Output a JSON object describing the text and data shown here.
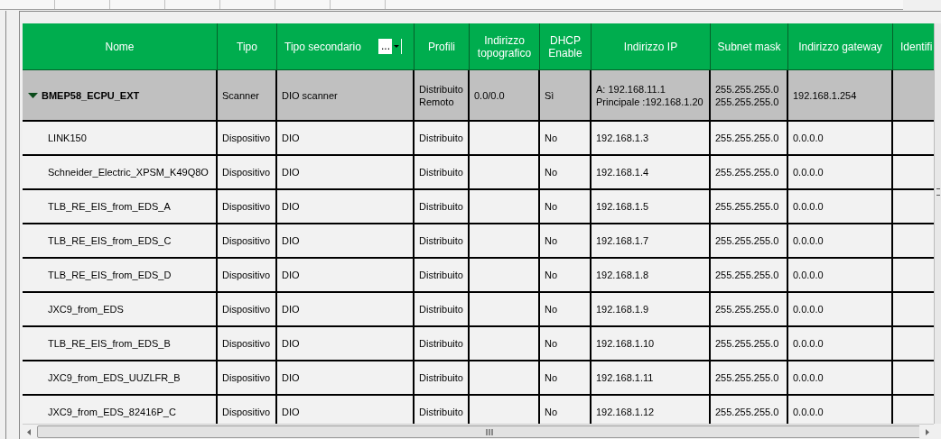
{
  "columns": [
    {
      "label": "Nome"
    },
    {
      "label": "Tipo"
    },
    {
      "label": "Tipo secondario",
      "filter": "..."
    },
    {
      "label": "Profili"
    },
    {
      "label": "Indirizzo topografico"
    },
    {
      "label": "DHCP Enable"
    },
    {
      "label": "Indirizzo IP"
    },
    {
      "label": "Subnet mask"
    },
    {
      "label": "Indirizzo gateway"
    },
    {
      "label": "Identifi"
    }
  ],
  "group": {
    "nome": "BMEP58_ECPU_EXT",
    "expanded": true,
    "tipo": "Scanner",
    "tipo_secondario": "DIO scanner",
    "profili": [
      "Distribuito",
      "Remoto"
    ],
    "indirizzo_topografico": "0.0/0.0",
    "dhcp_enable": "Sì",
    "indirizzo_ip": [
      "A: 192.168.11.1",
      "Principale :192.168.1.20"
    ],
    "subnet_mask": [
      "255.255.255.0",
      "255.255.255.0"
    ],
    "indirizzo_gateway": "192.168.1.254"
  },
  "rows": [
    {
      "nome": "LINK150",
      "tipo": "Dispositivo",
      "tipo_secondario": "DIO",
      "profili": "Distribuito",
      "dhcp_enable": "No",
      "indirizzo_ip": "192.168.1.3",
      "subnet_mask": "255.255.255.0",
      "indirizzo_gateway": "0.0.0.0"
    },
    {
      "nome": "Schneider_Electric_XPSM_K49Q8O",
      "tipo": "Dispositivo",
      "tipo_secondario": "DIO",
      "profili": "Distribuito",
      "dhcp_enable": "No",
      "indirizzo_ip": "192.168.1.4",
      "subnet_mask": "255.255.255.0",
      "indirizzo_gateway": "0.0.0.0"
    },
    {
      "nome": "TLB_RE_EIS_from_EDS_A",
      "tipo": "Dispositivo",
      "tipo_secondario": "DIO",
      "profili": "Distribuito",
      "dhcp_enable": "No",
      "indirizzo_ip": "192.168.1.5",
      "subnet_mask": "255.255.255.0",
      "indirizzo_gateway": "0.0.0.0"
    },
    {
      "nome": "TLB_RE_EIS_from_EDS_C",
      "tipo": "Dispositivo",
      "tipo_secondario": "DIO",
      "profili": "Distribuito",
      "dhcp_enable": "No",
      "indirizzo_ip": "192.168.1.7",
      "subnet_mask": "255.255.255.0",
      "indirizzo_gateway": "0.0.0.0"
    },
    {
      "nome": "TLB_RE_EIS_from_EDS_D",
      "tipo": "Dispositivo",
      "tipo_secondario": "DIO",
      "profili": "Distribuito",
      "dhcp_enable": "No",
      "indirizzo_ip": "192.168.1.8",
      "subnet_mask": "255.255.255.0",
      "indirizzo_gateway": "0.0.0.0"
    },
    {
      "nome": "JXC9_from_EDS",
      "tipo": "Dispositivo",
      "tipo_secondario": "DIO",
      "profili": "Distribuito",
      "dhcp_enable": "No",
      "indirizzo_ip": "192.168.1.9",
      "subnet_mask": "255.255.255.0",
      "indirizzo_gateway": "0.0.0.0"
    },
    {
      "nome": "TLB_RE_EIS_from_EDS_B",
      "tipo": "Dispositivo",
      "tipo_secondario": "DIO",
      "profili": "Distribuito",
      "dhcp_enable": "No",
      "indirizzo_ip": "192.168.1.10",
      "subnet_mask": "255.255.255.0",
      "indirizzo_gateway": "0.0.0.0"
    },
    {
      "nome": "JXC9_from_EDS_UUZLFR_B",
      "tipo": "Dispositivo",
      "tipo_secondario": "DIO",
      "profili": "Distribuito",
      "dhcp_enable": "No",
      "indirizzo_ip": "192.168.1.11",
      "subnet_mask": "255.255.255.0",
      "indirizzo_gateway": "0.0.0.0"
    },
    {
      "nome": "JXC9_from_EDS_82416P_C",
      "tipo": "Dispositivo",
      "tipo_secondario": "DIO",
      "profili": "Distribuito",
      "dhcp_enable": "No",
      "indirizzo_ip": "192.168.1.12",
      "subnet_mask": "255.255.255.0",
      "indirizzo_gateway": "0.0.0.0"
    }
  ]
}
